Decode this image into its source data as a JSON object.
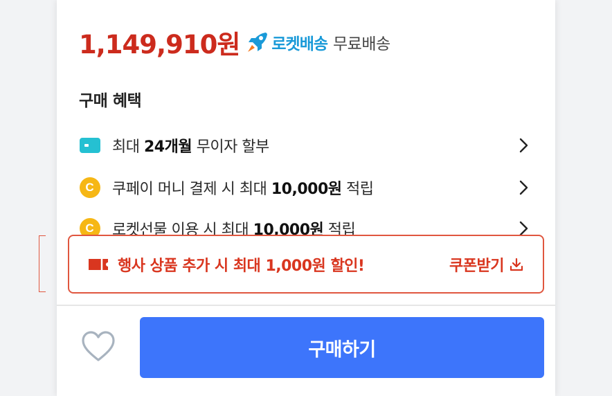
{
  "price": {
    "amount": "1,149,910원",
    "rocket_label": "로켓배송",
    "shipping_label": "무료배송"
  },
  "benefits": {
    "title": "구매 혜택",
    "items": [
      {
        "icon": "card-icon",
        "prefix": "최대 ",
        "bold": "24개월",
        "suffix": " 무이자 할부"
      },
      {
        "icon": "coin-icon",
        "coin_letter": "C",
        "prefix": "쿠페이 머니 결제 시 최대 ",
        "bold": "10,000원",
        "suffix": " 적립"
      },
      {
        "icon": "coin-icon",
        "coin_letter": "C",
        "prefix": "로켓선물 이용 시 최대 ",
        "bold": "10,000원",
        "suffix": " 적립"
      }
    ]
  },
  "coupon": {
    "text": "행사 상품 추가 시 최대 1,000원 할인!",
    "action_label": "쿠폰받기"
  },
  "footer": {
    "buy_label": "구매하기"
  },
  "colors": {
    "price_red": "#cc2b1d",
    "rocket_blue": "#1a9ad8",
    "coupon_red": "#d9361f",
    "buy_blue": "#3d75fb",
    "card_teal": "#25c0d2",
    "coin_yellow": "#f6b715"
  }
}
